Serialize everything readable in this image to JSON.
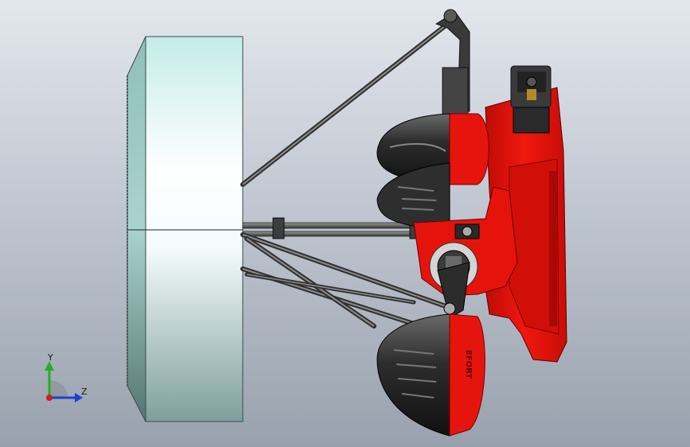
{
  "viewport": {
    "background_top": "#dfe4ec",
    "background_bottom": "#9aa3ae"
  },
  "model": {
    "platform_color": "#b9e6e3",
    "robot_red": "#e8140c",
    "robot_dark": "#2a2a2a",
    "rod_color": "#6a6a6a",
    "brand_text": "EFORT"
  },
  "triad": {
    "y_label": "Y",
    "z_label": "Z",
    "y_color": "#22b022",
    "z_color": "#1f3fd6",
    "x_color": "#d41a1a"
  }
}
